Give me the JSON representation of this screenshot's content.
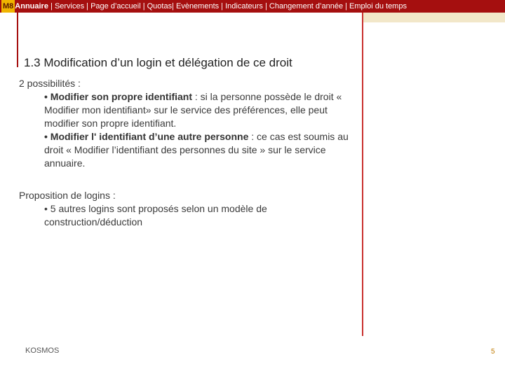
{
  "nav": {
    "m8": "M8",
    "annuaire": "Annuaire",
    "rest": " |  Services | Page d’accueil | Quotas| Evènements | Indicateurs |   Changement d’année  | Emploi du temps"
  },
  "slide": {
    "title": "1.3 Modification d’un login et délégation de ce droit",
    "intro": "2  possibilités :",
    "p1_bold": "• Modifier son propre identifiant",
    "p1_text": " : si la personne possède le droit « Modifier mon identifiant» sur le service des préférences, elle peut modifier son propre identifiant.",
    "p2_bold": "• Modifier l' identifiant d’une autre personne",
    "p2_text": " : ce cas est soumis au droit « Modifier l’identifiant des personnes du site » sur le service annuaire.",
    "section2": "Proposition de logins :",
    "p3": "•  5 autres logins sont proposés selon un modèle de construction/déduction"
  },
  "footer": {
    "brand": "KOSMOS",
    "page": "5"
  }
}
